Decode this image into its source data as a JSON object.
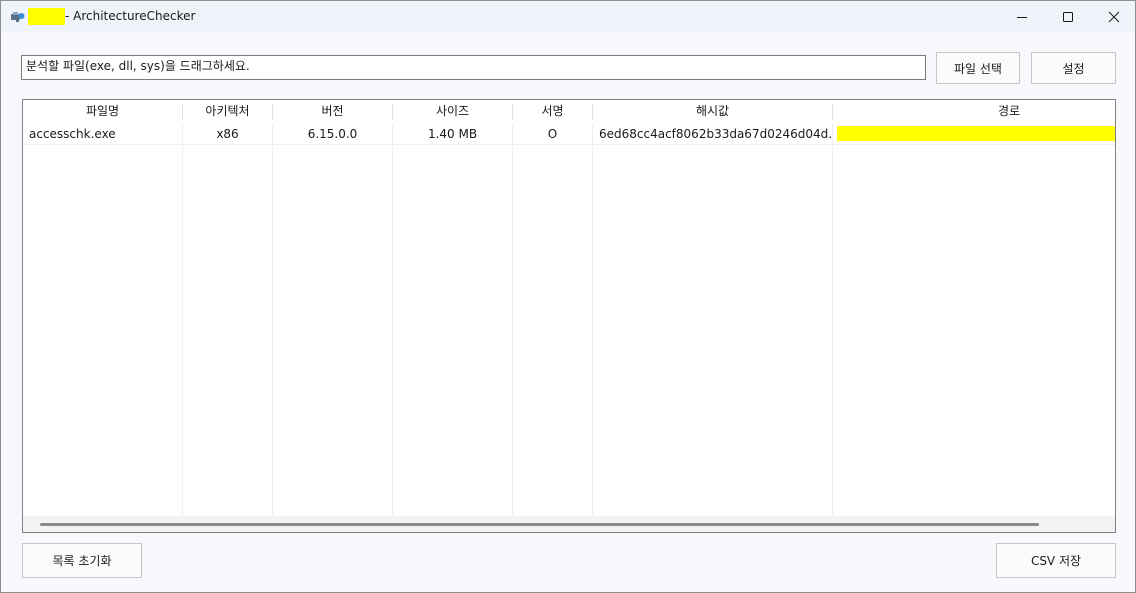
{
  "window": {
    "title": "- ArchitectureChecker",
    "controls": {
      "minimize": "minimize-icon",
      "maximize": "maximize-icon",
      "close": "close-icon"
    }
  },
  "toolbar": {
    "drop_prompt": "분석할 파일(exe, dll, sys)을 드래그하세요.",
    "select_file_label": "파일 선택",
    "settings_label": "설정"
  },
  "table": {
    "columns": [
      "파일명",
      "아키텍처",
      "버전",
      "사이즈",
      "서명",
      "해시값",
      "경로"
    ],
    "rows": [
      {
        "filename": "accesschk.exe",
        "architecture": "x86",
        "version": "6.15.0.0",
        "size": "1.40 MB",
        "signature": "O",
        "hash": "6ed68cc4acf8062b33da67d0246d04d...",
        "path": ""
      }
    ]
  },
  "footer": {
    "clear_list_label": "목록 초기화",
    "csv_save_label": "CSV 저장"
  },
  "colors": {
    "redaction": "#ffff00",
    "background": "#f7f8fc",
    "titlebar": "#f0f3f9"
  }
}
